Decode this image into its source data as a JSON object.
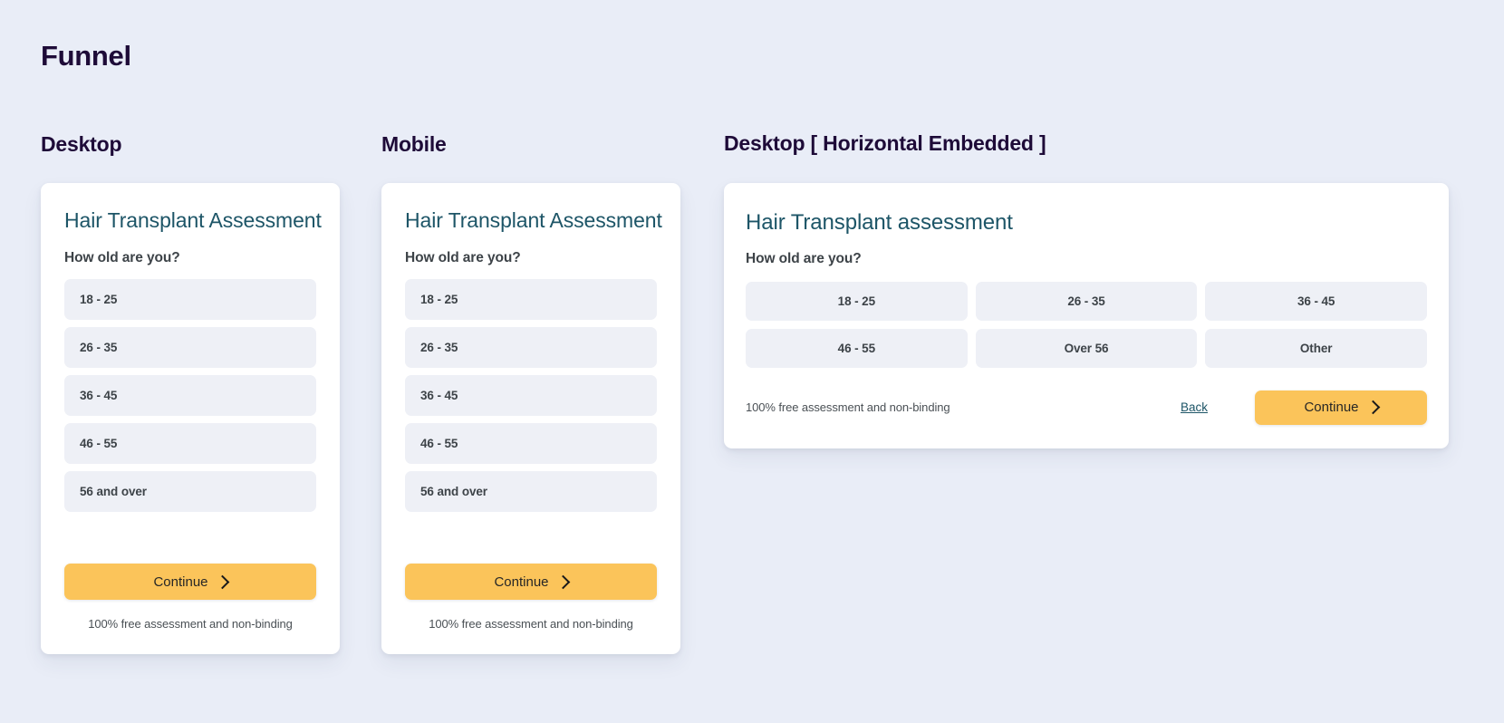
{
  "page": {
    "title": "Funnel",
    "background_color": "#e9edf7",
    "title_color": "#1e0b38"
  },
  "sections": [
    {
      "label": "Desktop"
    },
    {
      "label": "Mobile"
    },
    {
      "label": "Desktop [ Horizontal Embedded ]"
    }
  ],
  "colors": {
    "accent_button": "#fbc45a",
    "card_title": "#1d5567",
    "option_background": "#eef0f6",
    "text": "#3d4348"
  },
  "desktop_card": {
    "title": "Hair Transplant Assessment",
    "question": "How old are you?",
    "options": [
      "18 - 25",
      "26 - 35",
      "36 - 45",
      "46 - 55",
      "56 and over"
    ],
    "continue_label": "Continue",
    "disclaimer": "100% free assessment and non-binding"
  },
  "mobile_card": {
    "title": "Hair Transplant Assessment",
    "question": "How old are you?",
    "options": [
      "18 - 25",
      "26 - 35",
      "36 - 45",
      "46 - 55",
      "56 and over"
    ],
    "continue_label": "Continue",
    "disclaimer": "100% free assessment and non-binding"
  },
  "horizontal_card": {
    "title": "Hair Transplant assessment",
    "question": "How old are you?",
    "options": [
      "18 - 25",
      "26 - 35",
      "36 - 45",
      "46 - 55",
      "Over 56",
      "Other"
    ],
    "disclaimer": "100% free assessment and non-binding",
    "back_label": "Back",
    "continue_label": "Continue"
  }
}
